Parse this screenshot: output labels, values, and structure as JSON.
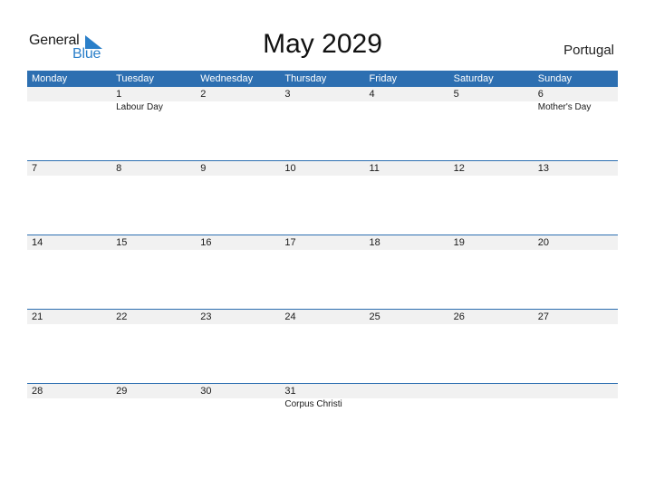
{
  "logo": {
    "word1": "General",
    "word2": "Blue"
  },
  "title": "May 2029",
  "country": "Portugal",
  "colors": {
    "header_bg": "#2d6fb1",
    "accent": "#2a7fc9",
    "date_strip": "#f1f1f1"
  },
  "weekdays": [
    "Monday",
    "Tuesday",
    "Wednesday",
    "Thursday",
    "Friday",
    "Saturday",
    "Sunday"
  ],
  "weeks": [
    [
      {
        "day": "",
        "holiday": ""
      },
      {
        "day": "1",
        "holiday": "Labour Day"
      },
      {
        "day": "2",
        "holiday": ""
      },
      {
        "day": "3",
        "holiday": ""
      },
      {
        "day": "4",
        "holiday": ""
      },
      {
        "day": "5",
        "holiday": ""
      },
      {
        "day": "6",
        "holiday": "Mother's Day"
      }
    ],
    [
      {
        "day": "7",
        "holiday": ""
      },
      {
        "day": "8",
        "holiday": ""
      },
      {
        "day": "9",
        "holiday": ""
      },
      {
        "day": "10",
        "holiday": ""
      },
      {
        "day": "11",
        "holiday": ""
      },
      {
        "day": "12",
        "holiday": ""
      },
      {
        "day": "13",
        "holiday": ""
      }
    ],
    [
      {
        "day": "14",
        "holiday": ""
      },
      {
        "day": "15",
        "holiday": ""
      },
      {
        "day": "16",
        "holiday": ""
      },
      {
        "day": "17",
        "holiday": ""
      },
      {
        "day": "18",
        "holiday": ""
      },
      {
        "day": "19",
        "holiday": ""
      },
      {
        "day": "20",
        "holiday": ""
      }
    ],
    [
      {
        "day": "21",
        "holiday": ""
      },
      {
        "day": "22",
        "holiday": ""
      },
      {
        "day": "23",
        "holiday": ""
      },
      {
        "day": "24",
        "holiday": ""
      },
      {
        "day": "25",
        "holiday": ""
      },
      {
        "day": "26",
        "holiday": ""
      },
      {
        "day": "27",
        "holiday": ""
      }
    ],
    [
      {
        "day": "28",
        "holiday": ""
      },
      {
        "day": "29",
        "holiday": ""
      },
      {
        "day": "30",
        "holiday": ""
      },
      {
        "day": "31",
        "holiday": "Corpus Christi"
      },
      {
        "day": "",
        "holiday": ""
      },
      {
        "day": "",
        "holiday": ""
      },
      {
        "day": "",
        "holiday": ""
      }
    ]
  ]
}
